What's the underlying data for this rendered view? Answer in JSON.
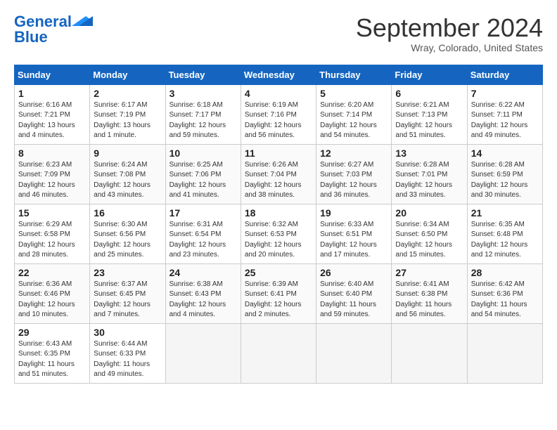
{
  "header": {
    "logo_line1": "General",
    "logo_line2": "Blue",
    "month": "September 2024",
    "location": "Wray, Colorado, United States"
  },
  "days_of_week": [
    "Sunday",
    "Monday",
    "Tuesday",
    "Wednesday",
    "Thursday",
    "Friday",
    "Saturday"
  ],
  "weeks": [
    [
      {
        "day": "1",
        "info": "Sunrise: 6:16 AM\nSunset: 7:21 PM\nDaylight: 13 hours\nand 4 minutes."
      },
      {
        "day": "2",
        "info": "Sunrise: 6:17 AM\nSunset: 7:19 PM\nDaylight: 13 hours\nand 1 minute."
      },
      {
        "day": "3",
        "info": "Sunrise: 6:18 AM\nSunset: 7:17 PM\nDaylight: 12 hours\nand 59 minutes."
      },
      {
        "day": "4",
        "info": "Sunrise: 6:19 AM\nSunset: 7:16 PM\nDaylight: 12 hours\nand 56 minutes."
      },
      {
        "day": "5",
        "info": "Sunrise: 6:20 AM\nSunset: 7:14 PM\nDaylight: 12 hours\nand 54 minutes."
      },
      {
        "day": "6",
        "info": "Sunrise: 6:21 AM\nSunset: 7:13 PM\nDaylight: 12 hours\nand 51 minutes."
      },
      {
        "day": "7",
        "info": "Sunrise: 6:22 AM\nSunset: 7:11 PM\nDaylight: 12 hours\nand 49 minutes."
      }
    ],
    [
      {
        "day": "8",
        "info": "Sunrise: 6:23 AM\nSunset: 7:09 PM\nDaylight: 12 hours\nand 46 minutes."
      },
      {
        "day": "9",
        "info": "Sunrise: 6:24 AM\nSunset: 7:08 PM\nDaylight: 12 hours\nand 43 minutes."
      },
      {
        "day": "10",
        "info": "Sunrise: 6:25 AM\nSunset: 7:06 PM\nDaylight: 12 hours\nand 41 minutes."
      },
      {
        "day": "11",
        "info": "Sunrise: 6:26 AM\nSunset: 7:04 PM\nDaylight: 12 hours\nand 38 minutes."
      },
      {
        "day": "12",
        "info": "Sunrise: 6:27 AM\nSunset: 7:03 PM\nDaylight: 12 hours\nand 36 minutes."
      },
      {
        "day": "13",
        "info": "Sunrise: 6:28 AM\nSunset: 7:01 PM\nDaylight: 12 hours\nand 33 minutes."
      },
      {
        "day": "14",
        "info": "Sunrise: 6:28 AM\nSunset: 6:59 PM\nDaylight: 12 hours\nand 30 minutes."
      }
    ],
    [
      {
        "day": "15",
        "info": "Sunrise: 6:29 AM\nSunset: 6:58 PM\nDaylight: 12 hours\nand 28 minutes."
      },
      {
        "day": "16",
        "info": "Sunrise: 6:30 AM\nSunset: 6:56 PM\nDaylight: 12 hours\nand 25 minutes."
      },
      {
        "day": "17",
        "info": "Sunrise: 6:31 AM\nSunset: 6:54 PM\nDaylight: 12 hours\nand 23 minutes."
      },
      {
        "day": "18",
        "info": "Sunrise: 6:32 AM\nSunset: 6:53 PM\nDaylight: 12 hours\nand 20 minutes."
      },
      {
        "day": "19",
        "info": "Sunrise: 6:33 AM\nSunset: 6:51 PM\nDaylight: 12 hours\nand 17 minutes."
      },
      {
        "day": "20",
        "info": "Sunrise: 6:34 AM\nSunset: 6:50 PM\nDaylight: 12 hours\nand 15 minutes."
      },
      {
        "day": "21",
        "info": "Sunrise: 6:35 AM\nSunset: 6:48 PM\nDaylight: 12 hours\nand 12 minutes."
      }
    ],
    [
      {
        "day": "22",
        "info": "Sunrise: 6:36 AM\nSunset: 6:46 PM\nDaylight: 12 hours\nand 10 minutes."
      },
      {
        "day": "23",
        "info": "Sunrise: 6:37 AM\nSunset: 6:45 PM\nDaylight: 12 hours\nand 7 minutes."
      },
      {
        "day": "24",
        "info": "Sunrise: 6:38 AM\nSunset: 6:43 PM\nDaylight: 12 hours\nand 4 minutes."
      },
      {
        "day": "25",
        "info": "Sunrise: 6:39 AM\nSunset: 6:41 PM\nDaylight: 12 hours\nand 2 minutes."
      },
      {
        "day": "26",
        "info": "Sunrise: 6:40 AM\nSunset: 6:40 PM\nDaylight: 11 hours\nand 59 minutes."
      },
      {
        "day": "27",
        "info": "Sunrise: 6:41 AM\nSunset: 6:38 PM\nDaylight: 11 hours\nand 56 minutes."
      },
      {
        "day": "28",
        "info": "Sunrise: 6:42 AM\nSunset: 6:36 PM\nDaylight: 11 hours\nand 54 minutes."
      }
    ],
    [
      {
        "day": "29",
        "info": "Sunrise: 6:43 AM\nSunset: 6:35 PM\nDaylight: 11 hours\nand 51 minutes."
      },
      {
        "day": "30",
        "info": "Sunrise: 6:44 AM\nSunset: 6:33 PM\nDaylight: 11 hours\nand 49 minutes."
      },
      {
        "day": "",
        "info": ""
      },
      {
        "day": "",
        "info": ""
      },
      {
        "day": "",
        "info": ""
      },
      {
        "day": "",
        "info": ""
      },
      {
        "day": "",
        "info": ""
      }
    ]
  ]
}
